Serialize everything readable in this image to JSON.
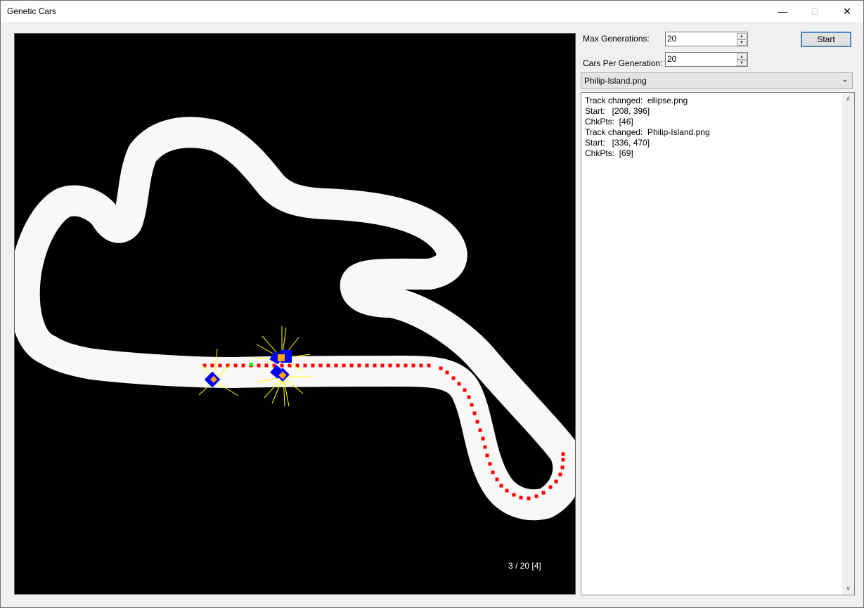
{
  "window": {
    "title": "Genetic Cars"
  },
  "controls": {
    "max_generations_label": "Max Generations:",
    "max_generations_value": "20",
    "cars_per_generation_label": "Cars Per Generation:",
    "cars_per_generation_value": "20",
    "start_label": "Start",
    "track_selected": "Philip-Island.png"
  },
  "canvas": {
    "generation_counter": "3 / 20 [4]",
    "colors": {
      "background": "#000000",
      "track": "#f8f8f8",
      "path": "#ff0000",
      "car_body": "#0000ff",
      "car_top": "#ffa500",
      "sensors": "#ffff00",
      "start_marker": "#00ff00"
    }
  },
  "log": {
    "lines": [
      "Track changed:  ellipse.png",
      "Start:   [208, 396]",
      "ChkPts:  [46]",
      "Track changed:  Philip-Island.png",
      "Start:   [336, 470]",
      "ChkPts:  [69]"
    ]
  },
  "icons": {
    "minimize": "minimize-icon",
    "maximize": "maximize-icon",
    "close": "close-icon",
    "spin_up": "spin-up-icon",
    "spin_down": "spin-down-icon",
    "dropdown": "chevron-down-icon"
  }
}
